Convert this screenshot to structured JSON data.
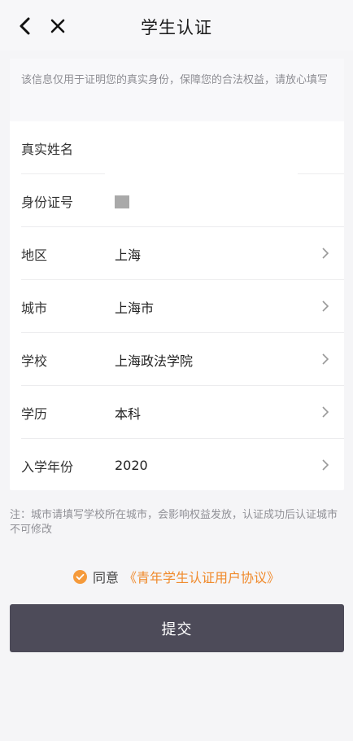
{
  "header": {
    "title": "学生认证",
    "back_icon": "chevron-left-icon",
    "close_icon": "close-icon"
  },
  "notice": "该信息仅用于证明您的真实身份，保障您的合法权益，请放心填写",
  "form": {
    "name_label": "真实姓名",
    "id_label": "身份证号",
    "rows": [
      {
        "label": "地区",
        "value": "上海"
      },
      {
        "label": "城市",
        "value": "上海市"
      },
      {
        "label": "学校",
        "value": "上海政法学院"
      },
      {
        "label": "学历",
        "value": "本科"
      },
      {
        "label": "入学年份",
        "value": "2020"
      }
    ],
    "arrow_icon": "chevron-right-icon"
  },
  "note": "注：城市请填写学校所在城市，会影响权益发放，认证成功后认证城市不可修改",
  "agreement": {
    "text": "同意",
    "link": "《青年学生认证用户协议》",
    "checked": true,
    "accent": "#f08a2c"
  },
  "submit_label": "提交",
  "colors": {
    "button_bg": "#4d4b59",
    "page_bg": "#f5f5f7"
  }
}
